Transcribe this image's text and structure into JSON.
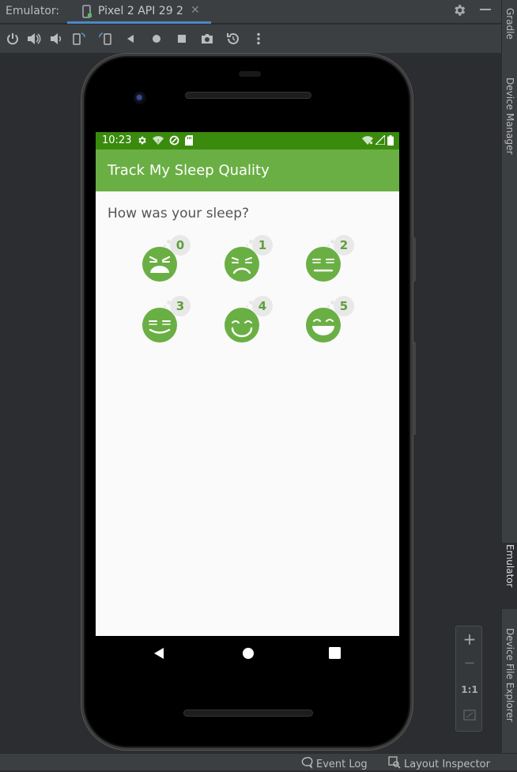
{
  "ide": {
    "emulator_label": "Emulator:",
    "device_tab": "Pixel 2 API 29 2",
    "close_glyph": "✕",
    "settings_icon": "gear-icon",
    "minimize_icon": "minus-icon"
  },
  "toolbar": {
    "buttons": [
      "power",
      "volume-up",
      "volume-down",
      "rotate-left",
      "rotate-right",
      "back",
      "home",
      "overview",
      "screenshot",
      "snapshot",
      "more"
    ]
  },
  "right_panel": {
    "tabs": [
      "Gradle",
      "Device Manager",
      "Emulator",
      "Device File Explorer"
    ]
  },
  "bottom_bar": {
    "event_log": "Event Log",
    "layout_inspector": "Layout Inspector"
  },
  "zoom": {
    "plus": "+",
    "minus": "−",
    "one_to_one": "1:1"
  },
  "device": {
    "status_time": "10:23",
    "app_title": "Track My Sleep Quality",
    "question": "How was your sleep?",
    "ratings": [
      {
        "value": "0",
        "mood": "very-sad"
      },
      {
        "value": "1",
        "mood": "sad"
      },
      {
        "value": "2",
        "mood": "neutral"
      },
      {
        "value": "3",
        "mood": "slight-smile"
      },
      {
        "value": "4",
        "mood": "smile"
      },
      {
        "value": "5",
        "mood": "very-happy"
      }
    ]
  },
  "colors": {
    "status_bar": "#3a8a0e",
    "app_bar": "#6aaf44",
    "face_green": "#6aaf44",
    "accent_tab": "#4a88c7"
  }
}
